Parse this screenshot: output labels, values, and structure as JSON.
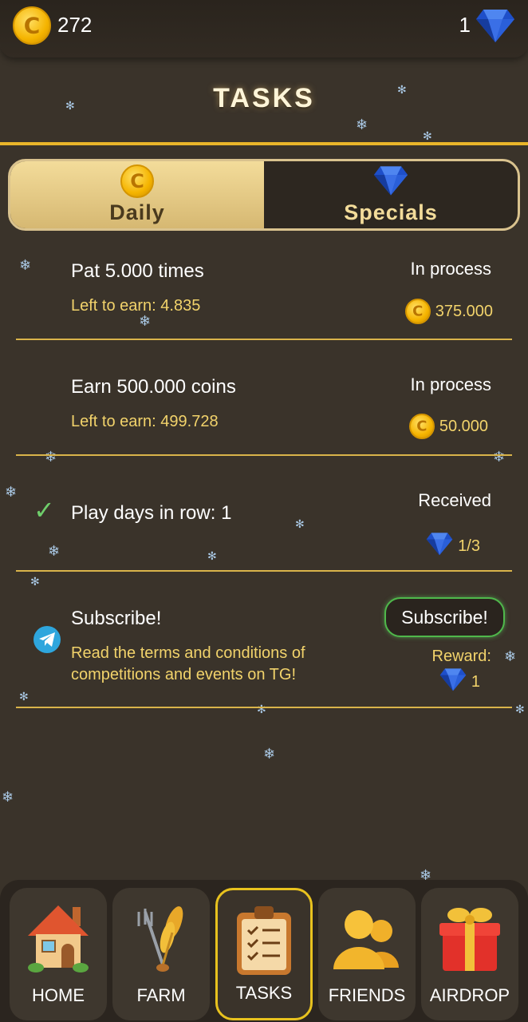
{
  "header": {
    "coins": "272",
    "gems": "1",
    "coin_icon": "coin-icon",
    "gem_icon": "gem-icon"
  },
  "page": {
    "title": "TASKS"
  },
  "tabs": [
    {
      "label": "Daily",
      "icon": "coin-icon",
      "active": true
    },
    {
      "label": "Specials",
      "icon": "gem-icon",
      "active": false
    }
  ],
  "tasks": [
    {
      "name": "Pat 5.000 times",
      "sub": "Left to earn: 4.835",
      "status": "In process",
      "reward": "375.000",
      "reward_icon": "coin-icon"
    },
    {
      "name": "Earn 500.000 coins",
      "sub": "Left to earn: 499.728",
      "status": "In process",
      "reward": "50.000",
      "reward_icon": "coin-icon"
    },
    {
      "name": "Play days in row: 1",
      "status": "Received",
      "reward": "1/3",
      "reward_icon": "gem-icon",
      "lead_icon": "check-icon"
    },
    {
      "name": "Subscribe!",
      "sub": "Read the terms and conditions of competitions and events on TG!",
      "button": "Subscribe!",
      "reward_label": "Reward:",
      "reward": "1",
      "reward_icon": "gem-icon",
      "lead_icon": "telegram-icon"
    }
  ],
  "nav": [
    {
      "label": "HOME",
      "icon": "house-icon"
    },
    {
      "label": "FARM",
      "icon": "wheat-pitchfork-icon"
    },
    {
      "label": "TASKS",
      "icon": "clipboard-icon",
      "active": true
    },
    {
      "label": "FRIENDS",
      "icon": "friends-icon"
    },
    {
      "label": "AIRDROP",
      "icon": "gift-icon"
    }
  ],
  "colors": {
    "background": "#3a332a",
    "accent_gold": "#e9b52a",
    "reward_text": "#f2d36b",
    "check_green": "#6fcf6b",
    "active_nav_border": "#e8c21e"
  }
}
